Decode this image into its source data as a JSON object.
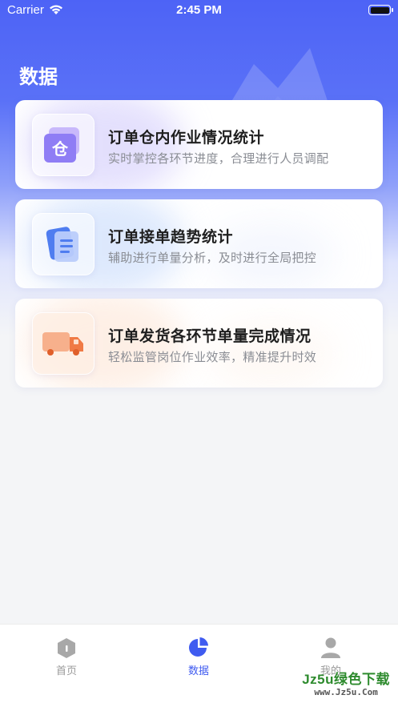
{
  "status_bar": {
    "carrier": "Carrier",
    "time": "2:45 PM"
  },
  "page": {
    "title": "数据"
  },
  "cards": [
    {
      "title": "订单仓内作业情况统计",
      "subtitle": "实时掌控各环节进度，合理进行人员调配",
      "icon": "warehouse-icon",
      "icon_glyph": "仓",
      "accent": "#8b7cf6"
    },
    {
      "title": "订单接单趋势统计",
      "subtitle": "辅助进行单量分析，及时进行全局把控",
      "icon": "document-icon",
      "accent": "#4f7df0"
    },
    {
      "title": "订单发货各环节单量完成情况",
      "subtitle": "轻松监管岗位作业效率，精准提升时效",
      "icon": "truck-icon",
      "accent": "#f07a45"
    }
  ],
  "tabs": [
    {
      "label": "首页",
      "icon": "home-icon",
      "active": false
    },
    {
      "label": "数据",
      "icon": "pie-chart-icon",
      "active": true
    },
    {
      "label": "我的",
      "icon": "user-icon",
      "active": false
    }
  ],
  "watermark": {
    "main": "Jz5u绿色下载",
    "sub": "www.Jz5u.Com"
  },
  "colors": {
    "primary": "#3f5bf0",
    "hero_top": "#4d63f6",
    "inactive_tab": "#9a9a9a"
  }
}
